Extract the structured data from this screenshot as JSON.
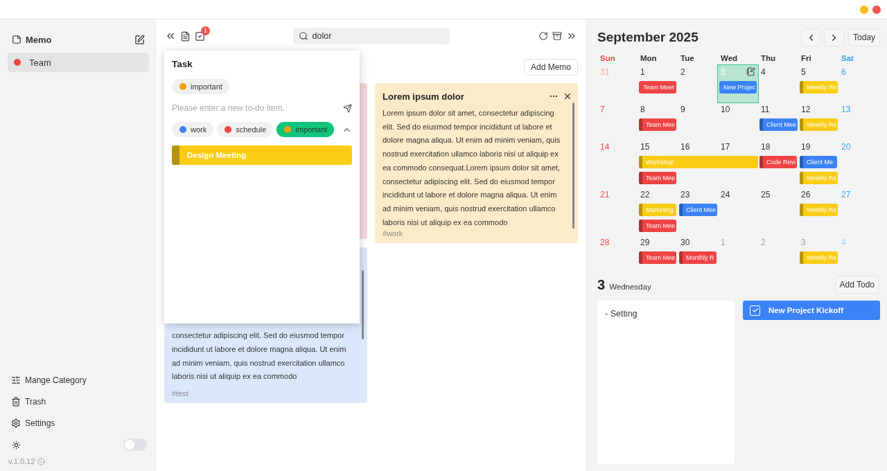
{
  "sidebar": {
    "title": "Memo",
    "categories": [
      {
        "name": "Team",
        "color": "#ef4444",
        "selected": true
      }
    ],
    "footer_items": [
      {
        "label": "Mange Category",
        "kind": "categories"
      },
      {
        "label": "Trash",
        "kind": "trash"
      },
      {
        "label": "Settings",
        "kind": "settings"
      }
    ],
    "theme_toggle": {
      "on": false
    },
    "version": "v.1.0.12"
  },
  "toolbar": {
    "task_badge": "1",
    "search": {
      "value": "dolor"
    }
  },
  "memos": {
    "add_button": "Add Memo",
    "columns": [
      {
        "cards": [
          {
            "color": "#f3d8da"
          },
          {
            "color": "#dbe8fb",
            "text": "consectetur adipiscing elit. Sed do eiusmod tempor incididunt ut labore et dolore magna aliqua. Ut enim ad minim veniam, quis nostrud exercitation ullamco laboris nisi ut aliquip ex ea commodo",
            "tag": "#test"
          }
        ]
      },
      {
        "cards": [
          {
            "color": "#fcebc8",
            "title": "Lorem ipsum dolor",
            "text": "Lorem ipsum dolor sit amet, consectetur adipiscing elit. Sed do eiusmod tempor incididunt ut labore et dolore magna aliqua. Ut enim ad minim veniam, quis nostrud exercitation ullamco laboris nisi ut aliquip ex ea commodo consequat.Lorem ipsum dolor sit amet, consectetur adipiscing elit. Sed do eiusmod tempor incididunt ut labore et dolore magna aliqua. Ut enim ad minim veniam, quis nostrud exercitation ullamco laboris nisi ut aliquip ex ea commodo",
            "tag": "#work"
          }
        ]
      }
    ]
  },
  "task_popup": {
    "title": "Task",
    "selected_tag": {
      "label": "important",
      "color": "#f59e0b"
    },
    "input": {
      "placeholder": "Please enter a new to-do item."
    },
    "filters": [
      {
        "label": "work",
        "color": "#3b82f6",
        "selected": false
      },
      {
        "label": "schedule",
        "color": "#ef4444",
        "selected": false
      },
      {
        "label": "important",
        "color": "#f59e0b",
        "selected": true
      }
    ],
    "expanded": true,
    "tasks": [
      {
        "title": "Design Meeting",
        "color": "#facc15"
      }
    ]
  },
  "calendar": {
    "title": "September 2025",
    "today_button": "Today",
    "weekdays": [
      "Sun",
      "Mon",
      "Tue",
      "Wed",
      "Thu",
      "Fri",
      "Sat"
    ],
    "weeks": [
      {
        "days": [
          {
            "date": "31",
            "muted": true,
            "selected": false
          },
          {
            "date": "1",
            "muted": false,
            "selected": false,
            "events": [
              {
                "title": "Team Meet",
                "color": "#ef4444",
                "accent": false
              }
            ]
          },
          {
            "date": "2",
            "muted": false,
            "selected": false
          },
          {
            "date": "3",
            "muted": false,
            "selected": true,
            "events": [
              {
                "title": "New Projec",
                "color": "#3b82f6",
                "accent": false
              }
            ]
          },
          {
            "date": "4",
            "muted": false,
            "selected": false
          },
          {
            "date": "5",
            "muted": false,
            "selected": false,
            "events": [
              {
                "title": "Weekly Re",
                "color": "#facc15",
                "accent": true
              }
            ]
          },
          {
            "date": "6",
            "muted": false,
            "selected": false
          }
        ]
      },
      {
        "days": [
          {
            "date": "7",
            "muted": false,
            "selected": false
          },
          {
            "date": "8",
            "muted": false,
            "selected": false,
            "events": [
              {
                "title": "Team Mee",
                "color": "#ef4444",
                "accent": true
              }
            ]
          },
          {
            "date": "9",
            "muted": false,
            "selected": false
          },
          {
            "date": "10",
            "muted": false,
            "selected": false
          },
          {
            "date": "11",
            "muted": false,
            "selected": false,
            "events": [
              {
                "title": "Client Mee",
                "color": "#3b82f6",
                "accent": true
              }
            ]
          },
          {
            "date": "12",
            "muted": false,
            "selected": false,
            "events": [
              {
                "title": "Weekly Re",
                "color": "#facc15",
                "accent": true
              }
            ]
          },
          {
            "date": "13",
            "muted": false,
            "selected": false
          }
        ]
      },
      {
        "days": [
          {
            "date": "14",
            "muted": false,
            "selected": false
          },
          {
            "date": "15",
            "muted": false,
            "selected": false,
            "events": [
              {
                "title": "Workshop",
                "color": "#facc15",
                "accent": true
              },
              {
                "title": "Team Mee",
                "color": "#ef4444",
                "accent": true
              }
            ]
          },
          {
            "date": "16",
            "muted": false,
            "selected": false,
            "events": [
              {
                "continued": true
              }
            ]
          },
          {
            "date": "17",
            "muted": false,
            "selected": false,
            "events": [
              {
                "continued": true
              }
            ]
          },
          {
            "date": "18",
            "muted": false,
            "selected": false,
            "events": [
              {
                "title": "Code Revi",
                "color": "#ef4444",
                "accent": true
              }
            ]
          },
          {
            "date": "19",
            "muted": false,
            "selected": false,
            "events": [
              {
                "title": "Client Me",
                "color": "#3b82f6",
                "accent": true
              },
              {
                "title": "Weekly Re",
                "color": "#facc15",
                "accent": true
              }
            ]
          },
          {
            "date": "20",
            "muted": false,
            "selected": false
          }
        ]
      },
      {
        "days": [
          {
            "date": "21",
            "muted": false,
            "selected": false
          },
          {
            "date": "22",
            "muted": false,
            "selected": false,
            "events": [
              {
                "title": "Marketing",
                "color": "#facc15",
                "accent": true
              },
              {
                "title": "Team Mee",
                "color": "#ef4444",
                "accent": true
              }
            ]
          },
          {
            "date": "23",
            "muted": false,
            "selected": false,
            "events": [
              {
                "title": "Client Mee",
                "color": "#3b82f6",
                "accent": true
              }
            ]
          },
          {
            "date": "24",
            "muted": false,
            "selected": false
          },
          {
            "date": "25",
            "muted": false,
            "selected": false
          },
          {
            "date": "26",
            "muted": false,
            "selected": false,
            "events": [
              {
                "title": "Weekly Re",
                "color": "#facc15",
                "accent": true
              }
            ]
          },
          {
            "date": "27",
            "muted": false,
            "selected": false
          }
        ]
      },
      {
        "days": [
          {
            "date": "28",
            "muted": false,
            "selected": false
          },
          {
            "date": "29",
            "muted": false,
            "selected": false,
            "events": [
              {
                "title": "Team Mee",
                "color": "#ef4444",
                "accent": true
              }
            ]
          },
          {
            "date": "30",
            "muted": false,
            "selected": false,
            "events": [
              {
                "title": "Monthly R",
                "color": "#ef4444",
                "accent": true
              }
            ]
          },
          {
            "date": "1",
            "muted": true,
            "selected": false
          },
          {
            "date": "2",
            "muted": true,
            "selected": false
          },
          {
            "date": "3",
            "muted": true,
            "selected": false,
            "events": [
              {
                "title": "Weekly Re",
                "color": "#facc15",
                "accent": true
              }
            ]
          },
          {
            "date": "4",
            "muted": true,
            "selected": false
          }
        ]
      }
    ]
  },
  "day_detail": {
    "date": "3",
    "weekday": "Wednesday",
    "add_button": "Add Todo",
    "memo": "- Setting",
    "todos": [
      {
        "title": "New Project Kickoff",
        "checked": true
      }
    ]
  }
}
